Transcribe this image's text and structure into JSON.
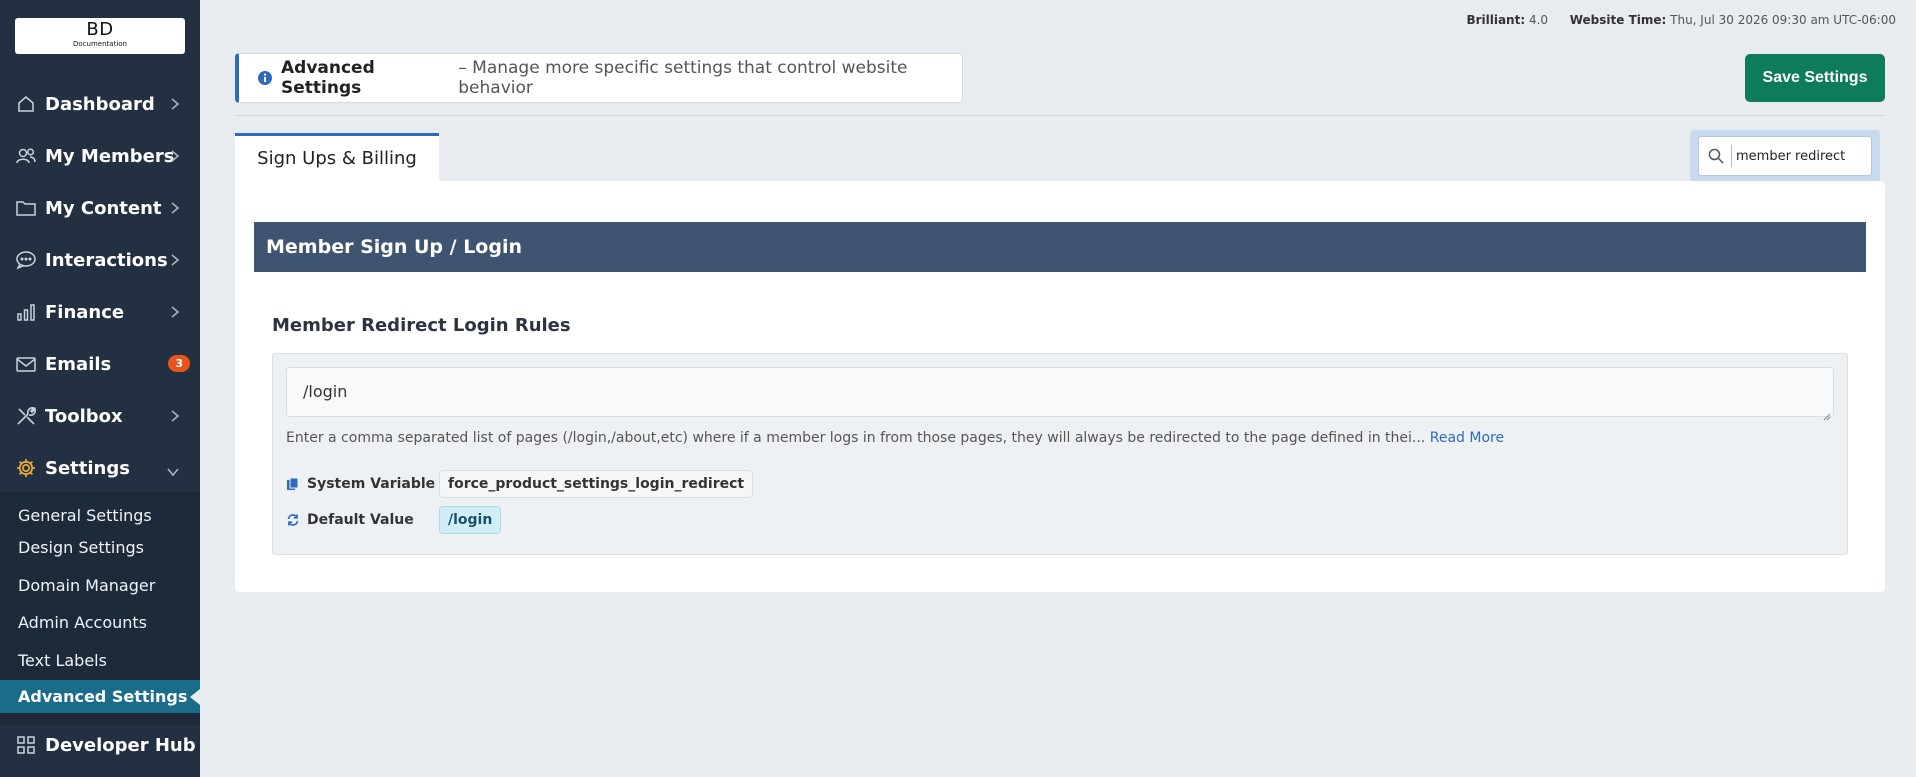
{
  "logo": {
    "main": "BD",
    "sub": "Documentation"
  },
  "sidebar": {
    "items": [
      {
        "label": "Dashboard",
        "icon": "home-icon"
      },
      {
        "label": "My Members",
        "icon": "users-icon"
      },
      {
        "label": "My Content",
        "icon": "folder-icon"
      },
      {
        "label": "Interactions",
        "icon": "chat-icon"
      },
      {
        "label": "Finance",
        "icon": "bar-chart-icon"
      },
      {
        "label": "Emails",
        "icon": "mail-icon",
        "badge": "3"
      },
      {
        "label": "Toolbox",
        "icon": "tools-icon"
      },
      {
        "label": "Settings",
        "icon": "gear-icon"
      },
      {
        "label": "Developer Hub",
        "icon": "grid-icon"
      }
    ],
    "sub_items": [
      {
        "label": "General Settings"
      },
      {
        "label": "Design Settings"
      },
      {
        "label": "Domain Manager"
      },
      {
        "label": "Admin Accounts"
      },
      {
        "label": "Text Labels"
      },
      {
        "label": "Advanced Settings",
        "active": true
      }
    ]
  },
  "topbar": {
    "version_label": "Brilliant:",
    "version_value": "4.0",
    "time_label": "Website Time:",
    "time_value": "Thu, Jul 30 2026 09:30 am UTC-06:00"
  },
  "header": {
    "title": "Advanced Settings",
    "description": "– Manage more specific settings that control website behavior",
    "save_label": "Save Settings"
  },
  "tabs": [
    {
      "label": "Sign Ups & Billing",
      "active": true
    }
  ],
  "search": {
    "value": "member redirect"
  },
  "section": {
    "title": "Member Sign Up / Login",
    "field": {
      "title": "Member Redirect Login Rules",
      "value": "/login",
      "help": "Enter a comma separated list of pages (/login,/about,etc) where if a member logs in from those pages, they will always be redirected to the page defined in thei...",
      "read_more": "Read More",
      "system_variable_label": "System Variable",
      "system_variable": "force_product_settings_login_redirect",
      "default_value_label": "Default Value",
      "default_value": "/login"
    }
  },
  "colors": {
    "sidebar_bg": "#223042",
    "accent_blue": "#2c6bbd",
    "save_green": "#0e7b5b",
    "section_header": "#3e5470",
    "active_sub": "#1b6c8b",
    "badge": "#e7551a"
  }
}
